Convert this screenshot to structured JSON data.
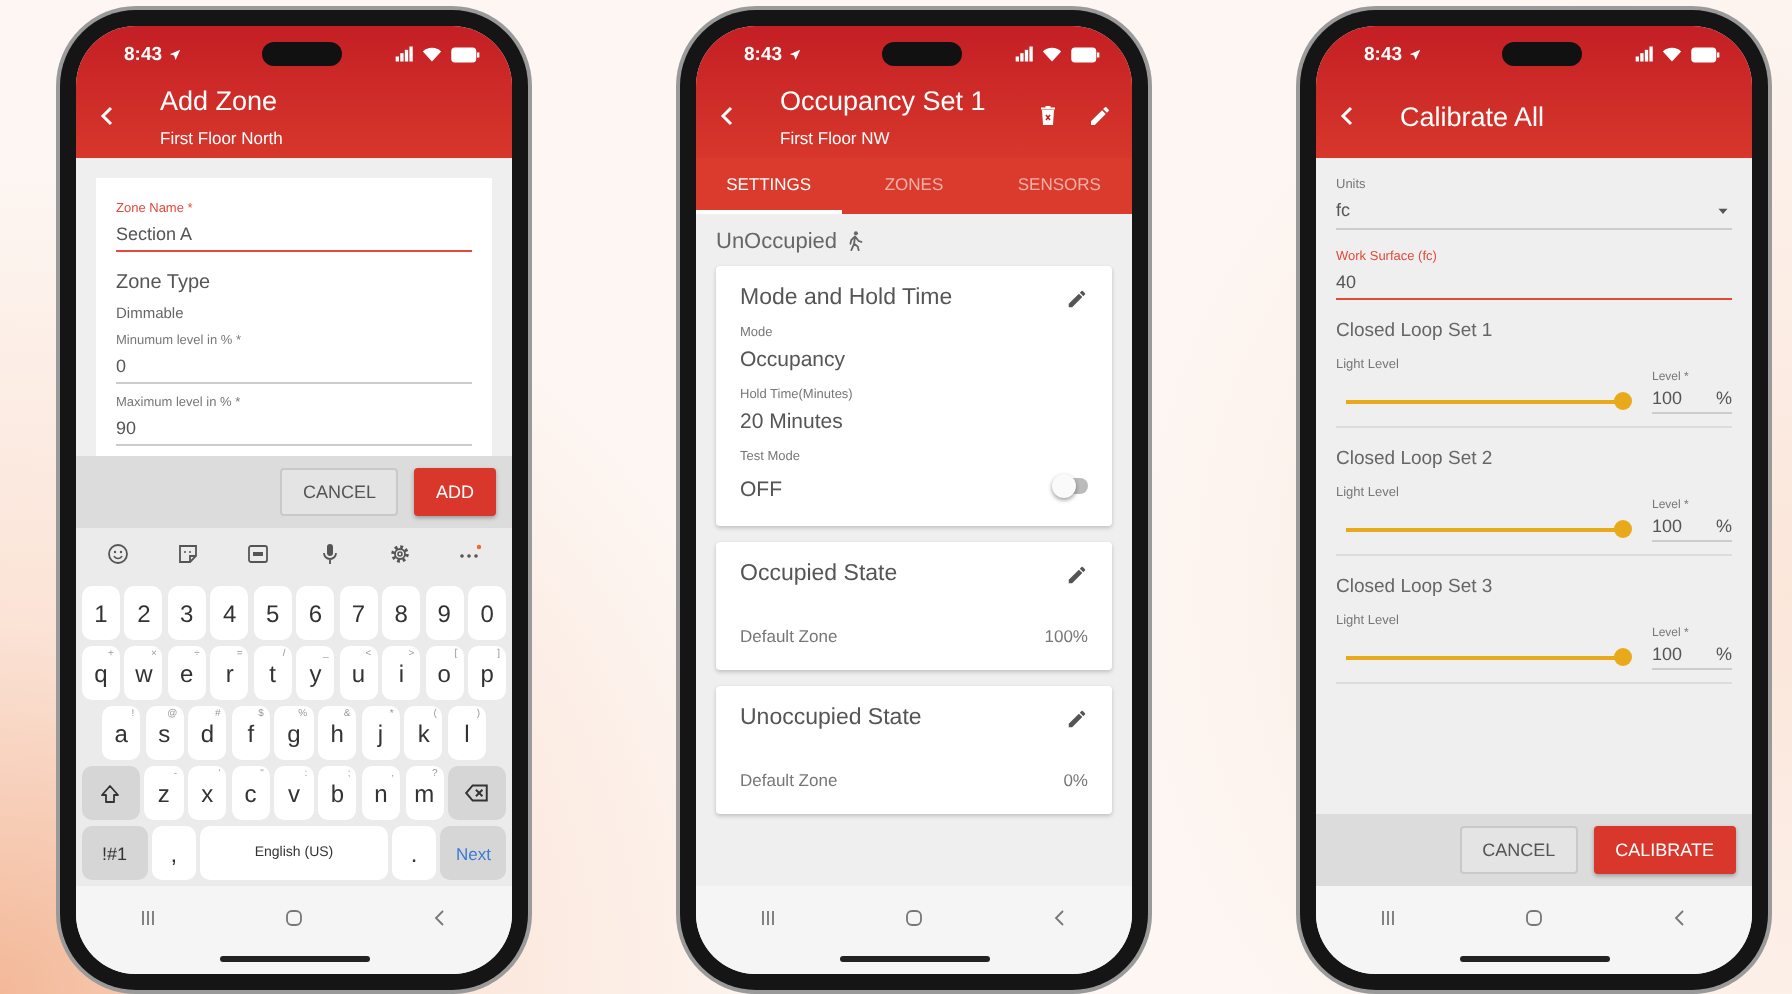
{
  "phones": [
    {
      "kind": "add_zone",
      "status_time": "8:43",
      "title": "Add Zone",
      "subtitle": "First Floor North",
      "fields": [
        {
          "kind": "text",
          "label": "Zone Name *",
          "value": "Section A",
          "focused": true
        },
        {
          "kind": "heading",
          "label": "Zone Type",
          "value": "Dimmable"
        },
        {
          "kind": "text",
          "label": "Minumum level in % *",
          "value": "0",
          "focused": false
        },
        {
          "kind": "text",
          "label": "Maximum level in % *",
          "value": "90",
          "focused": false
        }
      ],
      "buttons": [
        {
          "label": "CANCEL",
          "kind": "secondary"
        },
        {
          "label": "ADD",
          "kind": "primary"
        }
      ],
      "keyboard": {
        "rows": [
          {
            "keys": [
              {
                "kind": "char",
                "label": "1"
              },
              {
                "kind": "char",
                "label": "2"
              },
              {
                "kind": "char",
                "label": "3"
              },
              {
                "kind": "char",
                "label": "4"
              },
              {
                "kind": "char",
                "label": "5"
              },
              {
                "kind": "char",
                "label": "6"
              },
              {
                "kind": "char",
                "label": "7"
              },
              {
                "kind": "char",
                "label": "8"
              },
              {
                "kind": "char",
                "label": "9"
              },
              {
                "kind": "char",
                "label": "0"
              }
            ]
          },
          {
            "keys": [
              {
                "kind": "char",
                "label": "q",
                "hint": "+"
              },
              {
                "kind": "char",
                "label": "w",
                "hint": "×"
              },
              {
                "kind": "char",
                "label": "e",
                "hint": "÷"
              },
              {
                "kind": "char",
                "label": "r",
                "hint": "="
              },
              {
                "kind": "char",
                "label": "t",
                "hint": "/"
              },
              {
                "kind": "char",
                "label": "y",
                "hint": "_"
              },
              {
                "kind": "char",
                "label": "u",
                "hint": "<"
              },
              {
                "kind": "char",
                "label": "i",
                "hint": ">"
              },
              {
                "kind": "char",
                "label": "o",
                "hint": "["
              },
              {
                "kind": "char",
                "label": "p",
                "hint": "]"
              }
            ]
          },
          {
            "keys": [
              {
                "kind": "char",
                "label": "a",
                "hint": "!"
              },
              {
                "kind": "char",
                "label": "s",
                "hint": "@"
              },
              {
                "kind": "char",
                "label": "d",
                "hint": "#"
              },
              {
                "kind": "char",
                "label": "f",
                "hint": "$"
              },
              {
                "kind": "char",
                "label": "g",
                "hint": "%"
              },
              {
                "kind": "char",
                "label": "h",
                "hint": "&"
              },
              {
                "kind": "char",
                "label": "j",
                "hint": "*"
              },
              {
                "kind": "char",
                "label": "k",
                "hint": "("
              },
              {
                "kind": "char",
                "label": "l",
                "hint": ")"
              }
            ]
          },
          {
            "keys": [
              {
                "kind": "shift"
              },
              {
                "kind": "char",
                "label": "z",
                "hint": "-"
              },
              {
                "kind": "char",
                "label": "x",
                "hint": "'"
              },
              {
                "kind": "char",
                "label": "c",
                "hint": "\""
              },
              {
                "kind": "char",
                "label": "v",
                "hint": ":"
              },
              {
                "kind": "char",
                "label": "b",
                "hint": ";"
              },
              {
                "kind": "char",
                "label": "n",
                "hint": ","
              },
              {
                "kind": "char",
                "label": "m",
                "hint": "?"
              },
              {
                "kind": "backspace"
              }
            ]
          },
          {
            "keys": [
              {
                "kind": "mode",
                "label": "!#1"
              },
              {
                "kind": "char",
                "label": ","
              },
              {
                "kind": "space",
                "label": "English (US)"
              },
              {
                "kind": "char",
                "label": "."
              },
              {
                "kind": "action",
                "label": "Next"
              }
            ]
          }
        ]
      }
    },
    {
      "kind": "occupancy",
      "status_time": "8:43",
      "title": "Occupancy Set 1",
      "subtitle": "First Floor NW",
      "tabs": [
        {
          "label": "SETTINGS",
          "selected": true
        },
        {
          "label": "ZONES",
          "selected": false
        },
        {
          "label": "SENSORS",
          "selected": false
        }
      ],
      "state_label": "UnOccupied",
      "cards": [
        {
          "kind": "settings",
          "title": "Mode and Hold Time",
          "items": [
            {
              "label": "Mode",
              "value": "Occupancy"
            },
            {
              "label": "Hold Time(Minutes)",
              "value": "20 Minutes"
            }
          ],
          "toggle": {
            "label": "Test Mode",
            "value": "OFF",
            "on": false
          }
        },
        {
          "kind": "state",
          "title": "Occupied State",
          "rows": [
            {
              "name": "Default Zone",
              "value": "100%"
            }
          ]
        },
        {
          "kind": "state",
          "title": "Unoccupied State",
          "rows": [
            {
              "name": "Default Zone",
              "value": "0%"
            }
          ]
        }
      ]
    },
    {
      "kind": "calibrate",
      "status_time": "8:43",
      "title": "Calibrate All",
      "units": {
        "label": "Units",
        "value": "fc"
      },
      "work_surface": {
        "label": "Work Surface (fc)",
        "value": "40",
        "focused": true
      },
      "sets": [
        {
          "title": "Closed Loop Set 1",
          "slider_label": "Light Level",
          "level": 1,
          "input_label": "Level *",
          "value": "100",
          "unit": "%"
        },
        {
          "title": "Closed Loop Set 2",
          "slider_label": "Light Level",
          "level": 1,
          "input_label": "Level *",
          "value": "100",
          "unit": "%"
        },
        {
          "title": "Closed Loop Set 3",
          "slider_label": "Light Level",
          "level": 1,
          "input_label": "Level *",
          "value": "100",
          "unit": "%"
        }
      ],
      "buttons": [
        {
          "label": "CANCEL",
          "kind": "secondary"
        },
        {
          "label": "CALIBRATE",
          "kind": "primary"
        }
      ]
    }
  ]
}
